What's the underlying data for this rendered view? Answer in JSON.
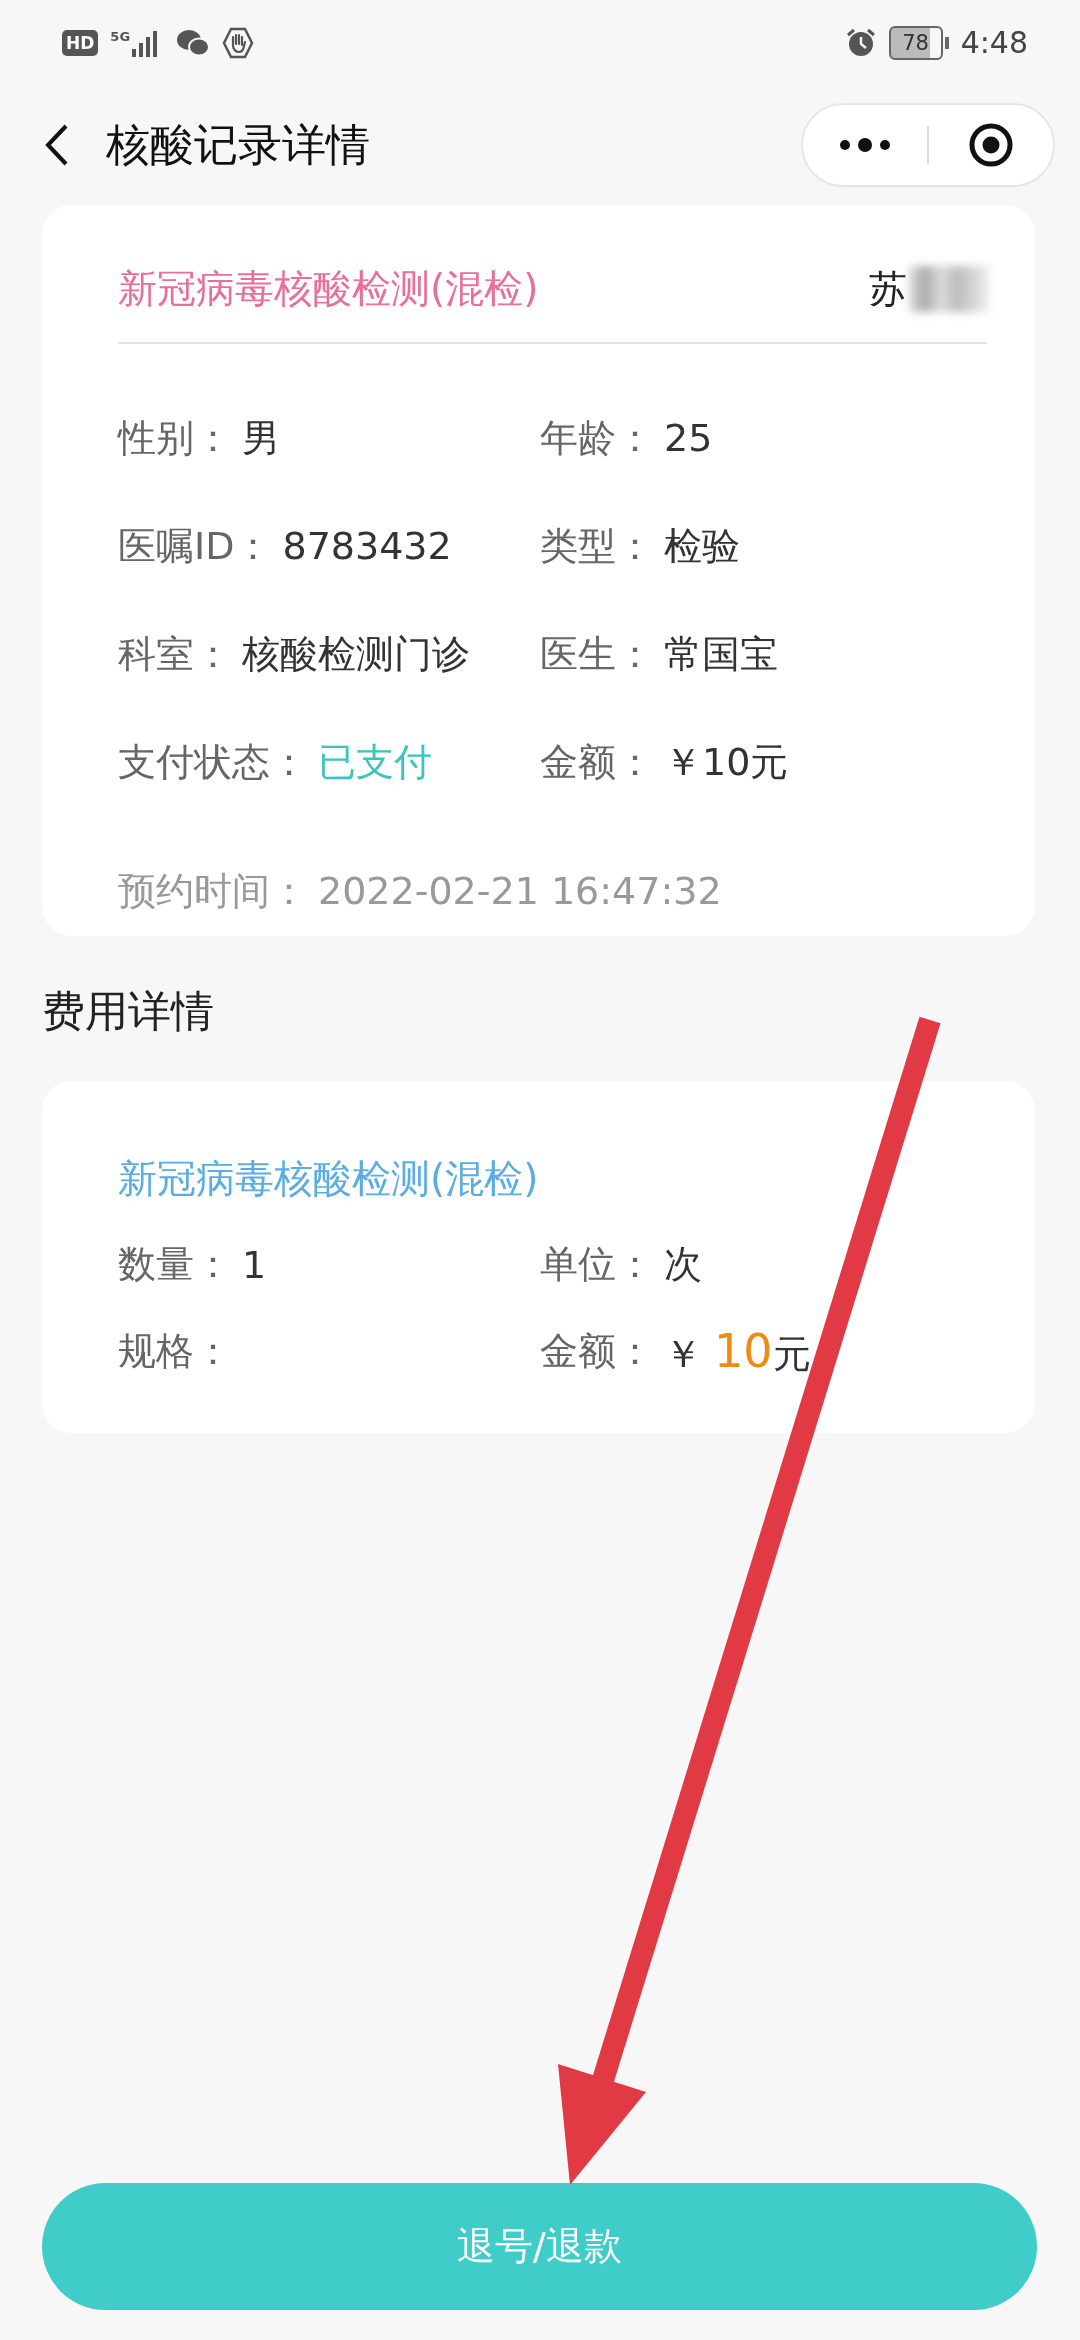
{
  "status_bar": {
    "badge": "HD",
    "network": "5G",
    "battery": "78",
    "time": "4:48"
  },
  "header": {
    "title": "核酸记录详情"
  },
  "record": {
    "title": "新冠病毒核酸检测(混检)",
    "patient": "苏",
    "fields": [
      {
        "label": "性别：",
        "value": "男",
        "kind": "text"
      },
      {
        "label": "年龄：",
        "value": "25",
        "kind": "text"
      },
      {
        "label": "医嘱ID：",
        "value": "8783432",
        "kind": "text"
      },
      {
        "label": "类型：",
        "value": "检验",
        "kind": "text"
      },
      {
        "label": "科室：",
        "value": "核酸检测门诊",
        "kind": "text"
      },
      {
        "label": "医生：",
        "value": "常国宝",
        "kind": "text"
      },
      {
        "label": "支付状态：",
        "value": "已支付",
        "kind": "status"
      },
      {
        "label": "金额：",
        "value": "￥10元",
        "kind": "text"
      }
    ],
    "appointment": {
      "label": "预约时间：",
      "value": "2022-02-21 16:47:32"
    }
  },
  "fee_section": {
    "title": "费用详情",
    "items": [
      {
        "name": "新冠病毒核酸检测(混检)",
        "fields": [
          {
            "label": "数量：",
            "value": "1",
            "kind": "text"
          },
          {
            "label": "单位：",
            "value": "次",
            "kind": "text"
          },
          {
            "label": "规格：",
            "kind": "empty"
          },
          {
            "label": "金额：",
            "kind": "money",
            "currency": "￥",
            "amount": "10",
            "unit": "元"
          }
        ]
      }
    ]
  },
  "action_button": {
    "label": "退号/退款"
  }
}
